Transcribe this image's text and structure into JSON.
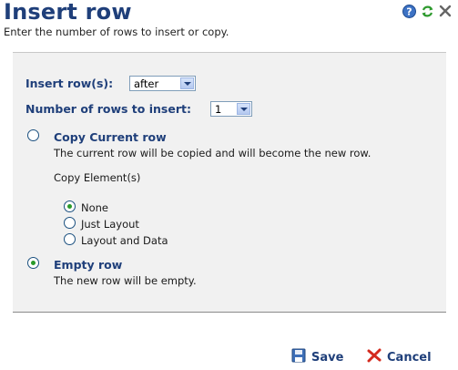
{
  "header": {
    "title": "Insert row",
    "subtitle": "Enter the number of rows to insert or copy."
  },
  "form": {
    "insert_label": "Insert row(s):",
    "insert_value": "after",
    "count_label": "Number of rows to insert:",
    "count_value": "1",
    "copy_title": "Copy Current row",
    "copy_desc": "The current row will be copied and will become the new row.",
    "copy_elements_label": "Copy Element(s)",
    "copy_options": [
      "None",
      "Just Layout",
      "Layout and Data"
    ],
    "empty_title": "Empty row",
    "empty_desc": "The new row will be empty."
  },
  "footer": {
    "save_label": "Save",
    "cancel_label": "Cancel"
  },
  "icons": [
    "help-icon",
    "refresh-icon",
    "close-icon",
    "save-icon",
    "cancel-icon"
  ],
  "colors": {
    "title": "#1f3f7a",
    "panel": "#f1f1f1",
    "radio_dot": "#2a9a2a",
    "cancel_x": "#d42a1e"
  }
}
